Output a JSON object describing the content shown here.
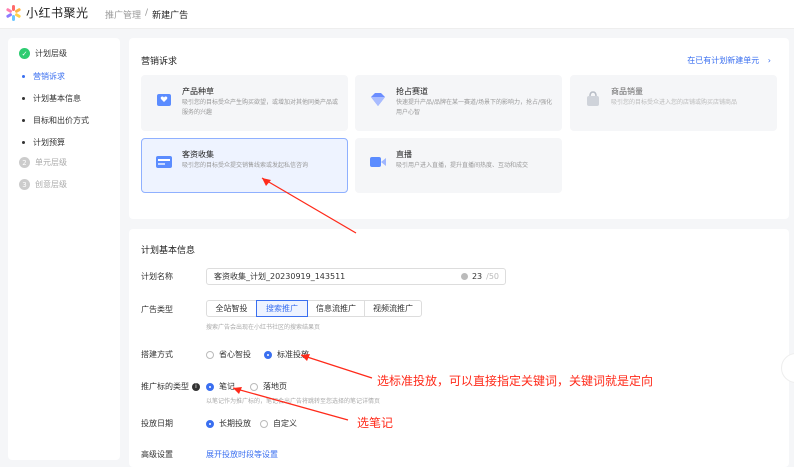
{
  "app": {
    "name": "小红书聚光"
  },
  "breadcrumb": {
    "parent": "推广管理",
    "sep": "/",
    "current": "新建广告"
  },
  "sidebar": {
    "steps": [
      {
        "label": "计划层级",
        "badge": "✓"
      },
      {
        "label": "营销诉求"
      },
      {
        "label": "计划基本信息"
      },
      {
        "label": "目标和出价方式"
      },
      {
        "label": "计划预算"
      },
      {
        "label": "单元层级",
        "badge": "2"
      },
      {
        "label": "创意层级",
        "badge": "3"
      }
    ]
  },
  "marketing": {
    "title": "营销诉求",
    "new_unit_link": "在已有计划新建单元",
    "cards": [
      {
        "title": "产品种草",
        "desc": "吸引您的目标受众产生购买欲望，或增加对其他同类产品或服务的兴趣"
      },
      {
        "title": "抢占赛道",
        "desc": "快速提升产品/品牌在某一赛道/场景下的影响力，抢占/强化用户心智"
      },
      {
        "title": "商品销量",
        "desc": "吸引您的目标受众进入您的店铺或购买店铺商品"
      },
      {
        "title": "客资收集",
        "desc": "吸引您的目标受众提交销售线索或发起私信咨询"
      },
      {
        "title": "直播",
        "desc": "吸引用户进入直播，提升直播间热度、互动和成交"
      }
    ]
  },
  "basic": {
    "title": "计划基本信息",
    "name_label": "计划名称",
    "name_value": "客资收集_计划_20230919_143511",
    "name_count": "23",
    "name_max": "/50",
    "adtype_label": "广告类型",
    "adtype_options": [
      "全站智投",
      "搜索推广",
      "信息流推广",
      "视频流推广"
    ],
    "adtype_hint": "搜索广告会出现在小红书社区的搜索结果页",
    "build_label": "搭建方式",
    "build_options": [
      "省心智投",
      "标准投放"
    ],
    "target_label": "推广标的类型",
    "target_options": [
      "笔记",
      "落地页"
    ],
    "target_hint": "以笔记作为推广标的，笔记会出广告将跳转至您选择的笔记详情页",
    "date_label": "投放日期",
    "date_options": [
      "长期投放",
      "自定义"
    ],
    "advanced_label": "高级设置",
    "advanced_link": "展开投放时段等设置"
  },
  "annotations": {
    "standard": "选标准投放，可以直接指定关键词，关键词就是定向",
    "note": "选笔记"
  },
  "colors": {
    "accent": "#3a6ff0",
    "annotation": "#ff2a1a"
  }
}
